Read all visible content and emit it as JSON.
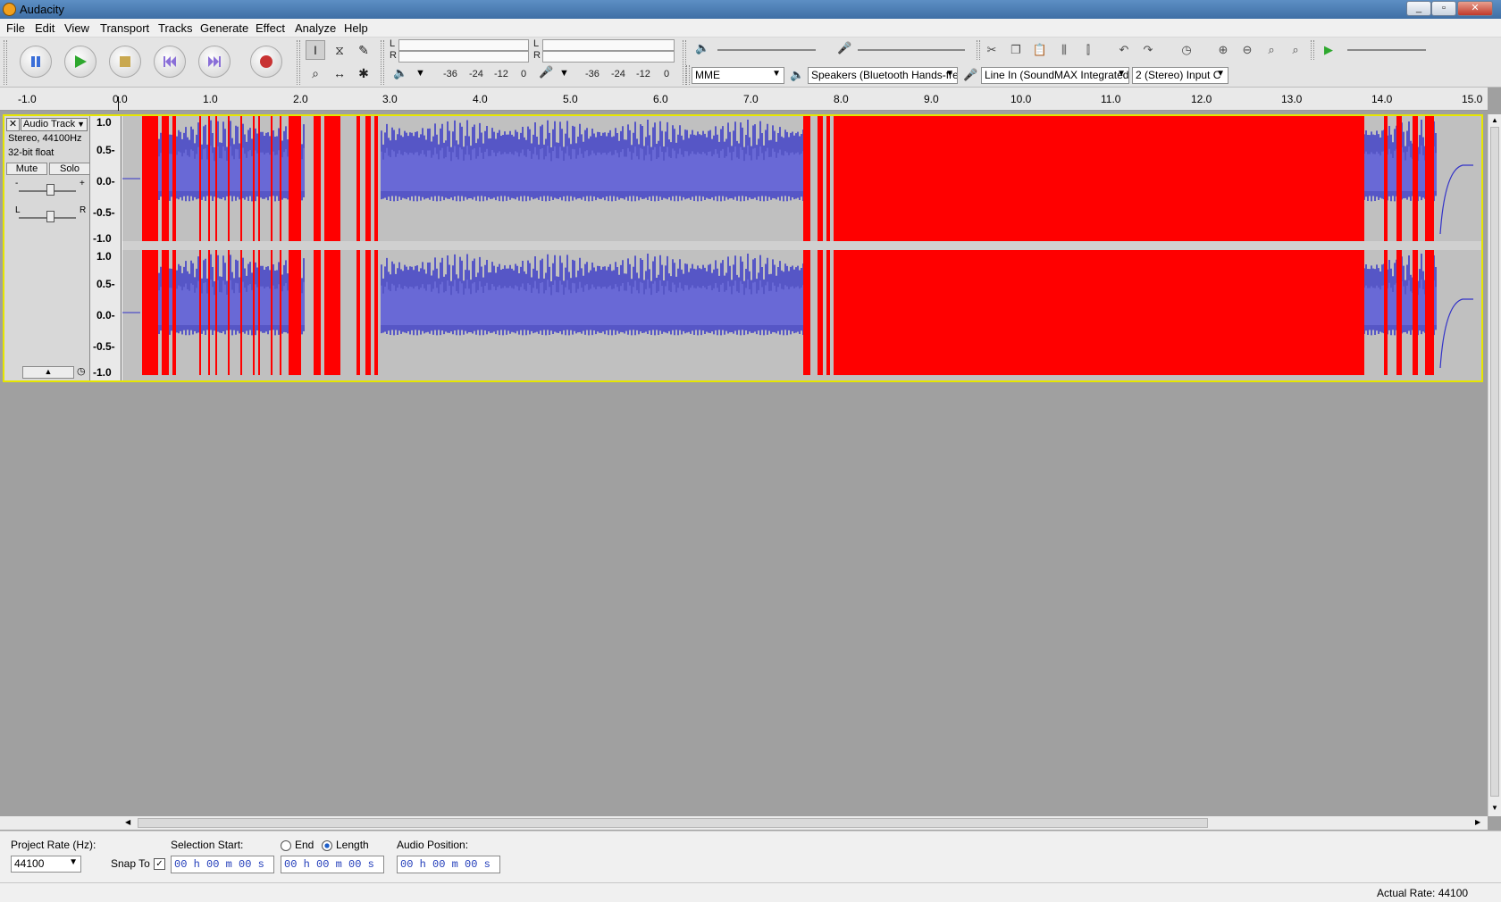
{
  "window": {
    "title": "Audacity",
    "buttons": [
      "_",
      "▫",
      "✕"
    ]
  },
  "menu": [
    "File",
    "Edit",
    "View",
    "Transport",
    "Tracks",
    "Generate",
    "Effect",
    "Analyze",
    "Help"
  ],
  "transport": {
    "icons": [
      "pause-icon",
      "play-icon",
      "stop-icon",
      "skip-start-icon",
      "skip-end-icon",
      "record-icon"
    ]
  },
  "tools": {
    "names": [
      "selection-tool",
      "envelope-tool",
      "draw-tool",
      "zoom-tool",
      "timeshift-tool",
      "multi-tool"
    ]
  },
  "meters": {
    "playback_channels": [
      "L",
      "R"
    ],
    "record_channels": [
      "L",
      "R"
    ],
    "scale": [
      "-36",
      "-24",
      "-12",
      "0"
    ]
  },
  "devices": {
    "host": "MME",
    "output": "Speakers (Bluetooth Hands-fre",
    "input": "Line In (SoundMAX Integrated",
    "channels": "2 (Stereo) Input C"
  },
  "ruler": [
    "-1.0",
    "0.0",
    "1.0",
    "2.0",
    "3.0",
    "4.0",
    "5.0",
    "6.0",
    "7.0",
    "8.0",
    "9.0",
    "10.0",
    "11.0",
    "12.0",
    "13.0",
    "14.0",
    "15.0"
  ],
  "track": {
    "name": "Audio Track",
    "info1": "Stereo, 44100Hz",
    "info2": "32-bit float",
    "mute": "Mute",
    "solo": "Solo",
    "gain_min": "-",
    "gain_max": "+",
    "pan_left": "L",
    "pan_right": "R",
    "vscale": [
      "1.0",
      "0.5-",
      "0.0-",
      "-0.5-",
      "-1.0"
    ],
    "clipping_color": "#ff0000",
    "wave_color": "#3232c8",
    "wave_rms_color": "#6464dc"
  },
  "selection_toolbar": {
    "project_rate_label": "Project Rate (Hz):",
    "project_rate": "44100",
    "snap_to_label": "Snap To",
    "snap_checked": "✓",
    "selection_start_label": "Selection Start:",
    "end_label": "End",
    "length_label": "Length",
    "audio_position_label": "Audio Position:",
    "selection_start": "00 h 00 m 00 s",
    "selection_length": "00 h 00 m 00 s",
    "audio_position": "00 h 00 m 00 s"
  },
  "status": {
    "actual_rate": "Actual Rate: 44100"
  }
}
